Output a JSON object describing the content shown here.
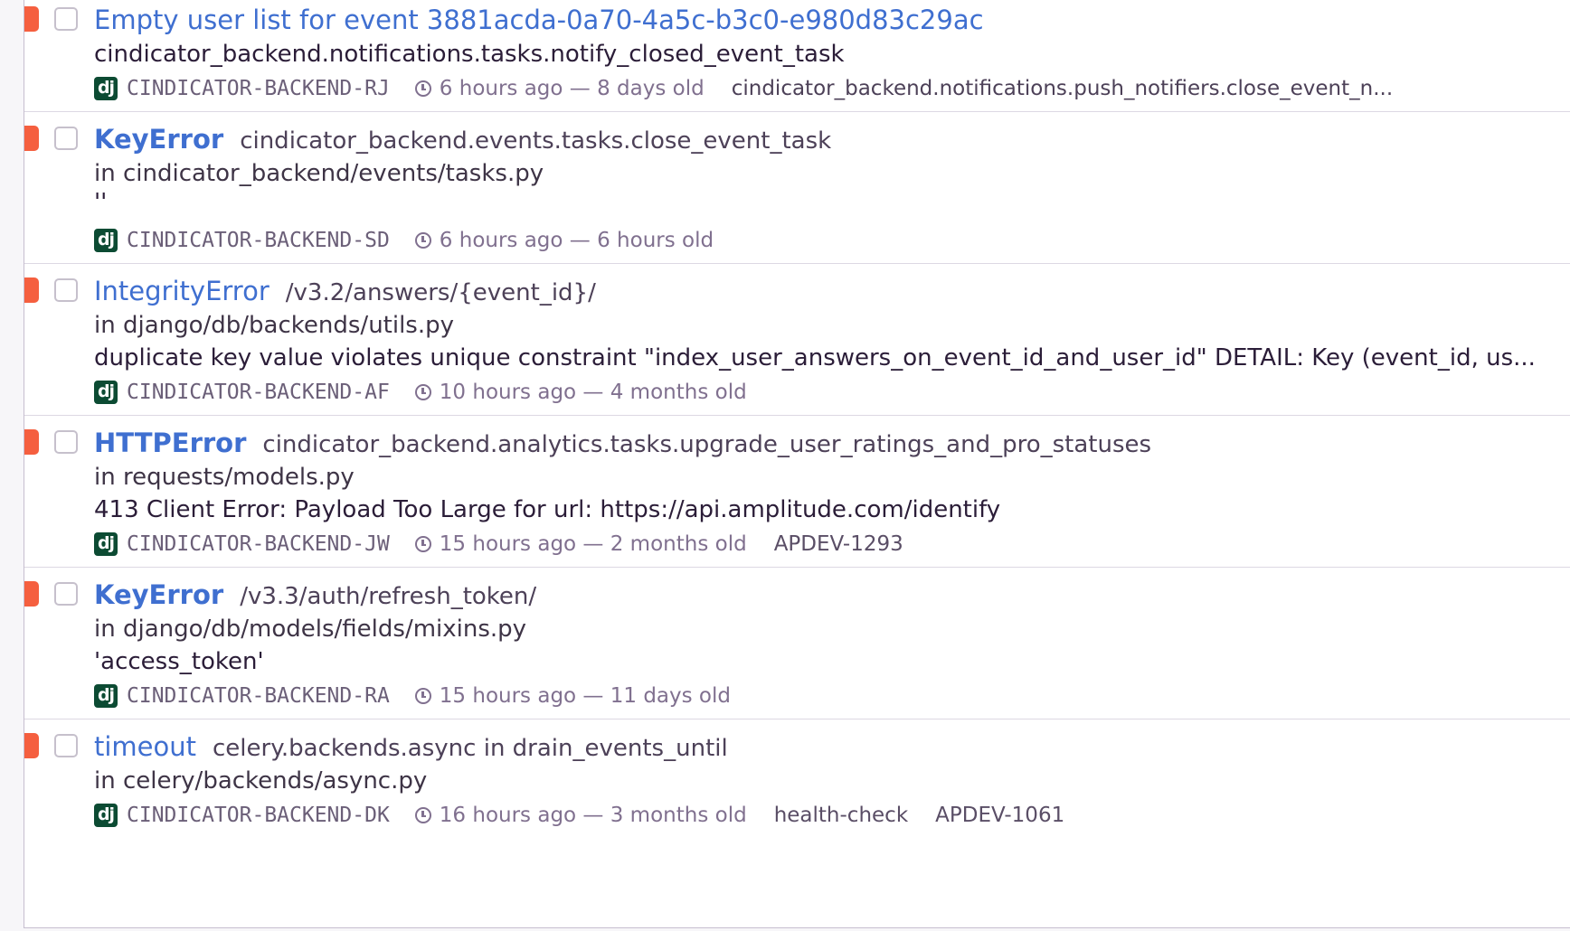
{
  "issues": [
    {
      "title": "Empty user list for event 3881acda-0a70-4a5c-b3c0-e980d83c29ac",
      "subtitle": "cindicator_backend.notifications.tasks.notify_closed_event_task",
      "short_id": "CINDICATOR-BACKEND-RJ",
      "times": "6 hours ago — 8 days old",
      "extra": "cindicator_backend.notifications.push_notifiers.close_event_n..."
    },
    {
      "title": "KeyError",
      "culprit": "cindicator_backend.events.tasks.close_event_task",
      "location": "in cindicator_backend/events/tasks.py",
      "message": "''",
      "short_id": "CINDICATOR-BACKEND-SD",
      "times": "6 hours ago — 6 hours old"
    },
    {
      "title": "IntegrityError",
      "culprit": "/v3.2/answers/{event_id}/",
      "location": "in django/db/backends/utils.py",
      "message": "duplicate key value violates unique constraint \"index_user_answers_on_event_id_and_user_id\" DETAIL: Key (event_id, us...",
      "short_id": "CINDICATOR-BACKEND-AF",
      "times": "10 hours ago — 4 months old"
    },
    {
      "title": "HTTPError",
      "culprit": "cindicator_backend.analytics.tasks.upgrade_user_ratings_and_pro_statuses",
      "location": "in requests/models.py",
      "message": "413 Client Error: Payload Too Large for url: https://api.amplitude.com/identify",
      "short_id": "CINDICATOR-BACKEND-JW",
      "times": "15 hours ago — 2 months old",
      "tag1": "APDEV-1293"
    },
    {
      "title": "KeyError",
      "culprit": "/v3.3/auth/refresh_token/",
      "location": "in django/db/models/fields/mixins.py",
      "message": "'access_token'",
      "short_id": "CINDICATOR-BACKEND-RA",
      "times": "15 hours ago — 11 days old"
    },
    {
      "title": "timeout",
      "culprit": "celery.backends.async in drain_events_until",
      "location": "in celery/backends/async.py",
      "short_id": "CINDICATOR-BACKEND-DK",
      "times": "16 hours ago — 3 months old",
      "tag1": "health-check",
      "tag2": "APDEV-1061"
    }
  ],
  "platform_badge": "dj",
  "colors": {
    "level_error": "#f55f3f",
    "title_link": "#3f6fd0",
    "django_badge": "#0c4b33"
  }
}
